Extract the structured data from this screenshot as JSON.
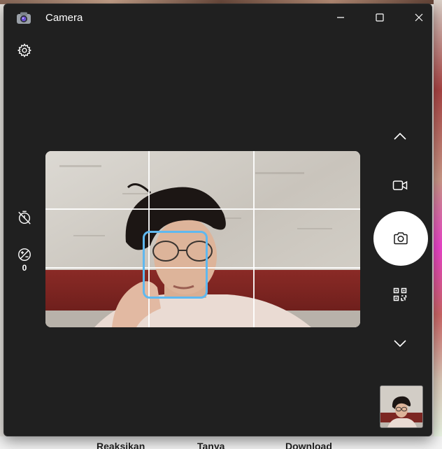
{
  "window": {
    "title": "Camera",
    "minimize_icon": "minimize-icon",
    "maximize_icon": "maximize-icon",
    "close_icon": "close-icon"
  },
  "left_toolbar": {
    "settings_icon": "gear-icon",
    "timer_icon": "timer-off-icon",
    "exposure_icon": "exposure-icon",
    "exposure_value": "0"
  },
  "right_toolbar": {
    "scroll_up_icon": "chevron-up-icon",
    "video_mode_icon": "video-camera-icon",
    "photo_capture_icon": "camera-icon",
    "qr_mode_icon": "qr-code-icon",
    "scroll_down_icon": "chevron-down-icon"
  },
  "viewfinder": {
    "grid": "rule-of-thirds",
    "face_detection": true
  },
  "colors": {
    "window_bg": "#202020",
    "face_box": "#5fb8ef",
    "shutter": "#ffffff"
  },
  "background_fragments": [
    "Reaksikan",
    "Tanya",
    "Download"
  ]
}
